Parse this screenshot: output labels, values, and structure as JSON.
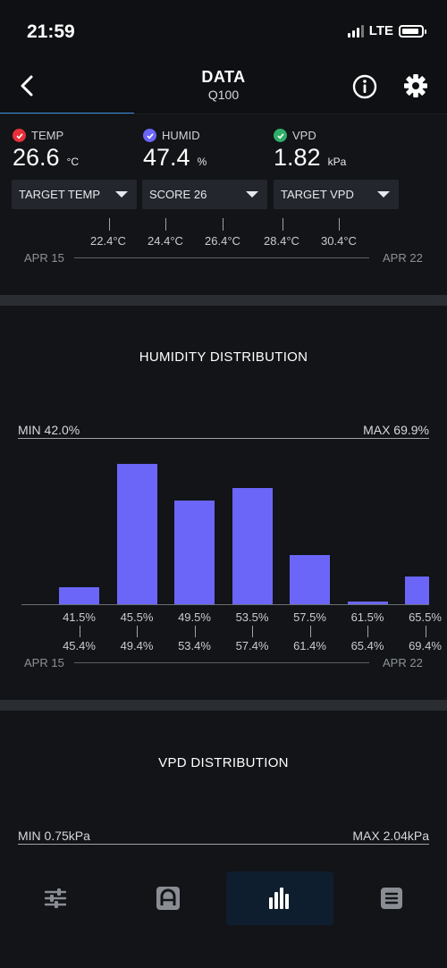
{
  "status": {
    "time": "21:59",
    "network": "LTE"
  },
  "header": {
    "title": "DATA",
    "subtitle": "Q100"
  },
  "metrics": {
    "temp": {
      "label": "TEMP",
      "value": "26.6",
      "unit": "°C",
      "color": "#e8303a"
    },
    "humid": {
      "label": "HUMID",
      "value": "47.4",
      "unit": "%",
      "color": "#6b66f8"
    },
    "vpd": {
      "label": "VPD",
      "value": "1.82",
      "unit": "kPa",
      "color": "#2fae6a"
    }
  },
  "dropdowns": {
    "target_temp": "TARGET TEMP",
    "score": "SCORE 26",
    "target_vpd": "TARGET VPD"
  },
  "temp_section": {
    "tick_labels": [
      "22.4°C",
      "24.4°C",
      "26.4°C",
      "28.4°C",
      "30.4°C"
    ],
    "date_start": "APR 15",
    "date_end": "APR 22"
  },
  "humidity": {
    "title": "HUMIDITY DISTRIBUTION",
    "min": "MIN 42.0%",
    "max": "MAX 69.9%",
    "date_start": "APR 15",
    "date_end": "APR 22"
  },
  "vpd_dist": {
    "title": "VPD DISTRIBUTION",
    "min": "MIN 0.75kPa",
    "max": "MAX 2.04kPa"
  },
  "chart_data": {
    "type": "bar",
    "title": "HUMIDITY DISTRIBUTION",
    "categories": [
      "41.5%-45.4%",
      "45.5%-49.4%",
      "49.5%-53.4%",
      "53.5%-57.4%",
      "57.5%-61.4%",
      "61.5%-65.4%",
      "65.5%-69.4%"
    ],
    "bin_low_labels": [
      "41.5%",
      "45.5%",
      "49.5%",
      "53.5%",
      "57.5%",
      "61.5%",
      "65.5%"
    ],
    "bin_high_labels": [
      "45.4%",
      "49.4%",
      "53.4%",
      "57.4%",
      "61.4%",
      "65.4%",
      "69.4%"
    ],
    "values": [
      12,
      100,
      74,
      83,
      35,
      2,
      20
    ],
    "ylim": [
      0,
      100
    ],
    "grid": false
  },
  "nav": {
    "items": [
      "controls",
      "automation",
      "data",
      "logs"
    ],
    "active": "data"
  }
}
